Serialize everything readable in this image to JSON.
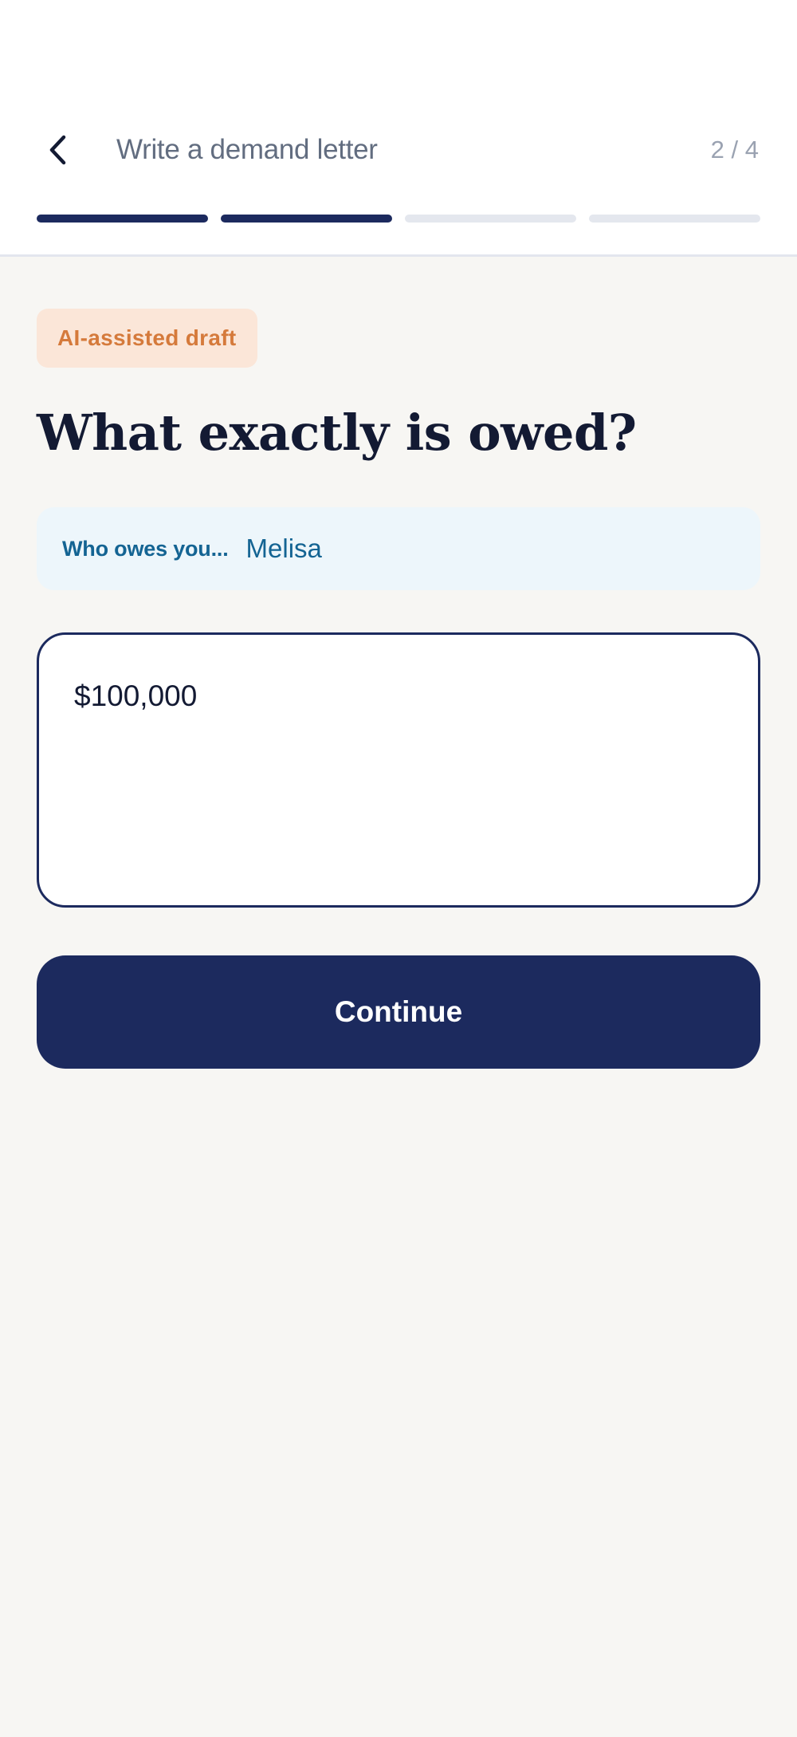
{
  "header": {
    "back_icon": "chevron-left-icon",
    "title": "Write a demand letter",
    "step_counter": "2 / 4",
    "progress": {
      "total_steps": 4,
      "completed_steps": 2
    }
  },
  "badge": {
    "label": "AI-assisted draft"
  },
  "question": {
    "text": "What exactly is owed?"
  },
  "context": {
    "label": "Who owes you...",
    "value": "Melisa"
  },
  "answer": {
    "value": "$100,000"
  },
  "actions": {
    "continue_label": "Continue"
  },
  "colors": {
    "primary": "#1c2a5e",
    "badge_bg": "#fbe6d8",
    "badge_text": "#d57a3b",
    "context_bg": "#edf6fb",
    "context_text": "#146493",
    "background": "#f7f6f3"
  }
}
